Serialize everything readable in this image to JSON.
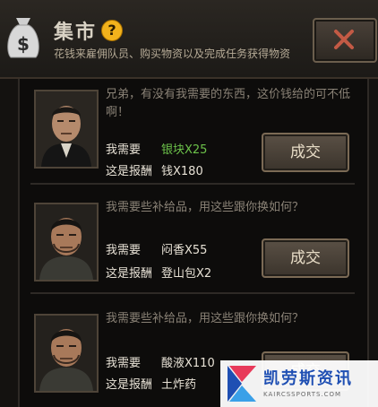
{
  "header": {
    "title": "集市",
    "help_symbol": "?",
    "subtitle": "花钱来雇佣队员、购买物资以及完成任务获得物资",
    "bag_symbol": "$"
  },
  "labels": {
    "need": "我需要",
    "reward": "这是报酬",
    "deal": "成交"
  },
  "offers": [
    {
      "message": "兄弟，有没有我需要的东西，这价钱给的可不低啊！",
      "need_value": "银块X25",
      "reward_value": "钱X180"
    },
    {
      "message": "我需要些补给品，用这些跟你换如何？",
      "need_value": "闷香X55",
      "reward_value": "登山包X2"
    },
    {
      "message": "我需要些补给品，用这些跟你换如何？",
      "need_value": "酸液X110",
      "reward_value": "土炸药"
    }
  ],
  "watermark": {
    "name": "凯劳斯资讯",
    "site": "KAIRCSSPORTS.COM"
  },
  "colors": {
    "need_ok": "#6cc24a",
    "help_badge": "#f2b21c"
  }
}
